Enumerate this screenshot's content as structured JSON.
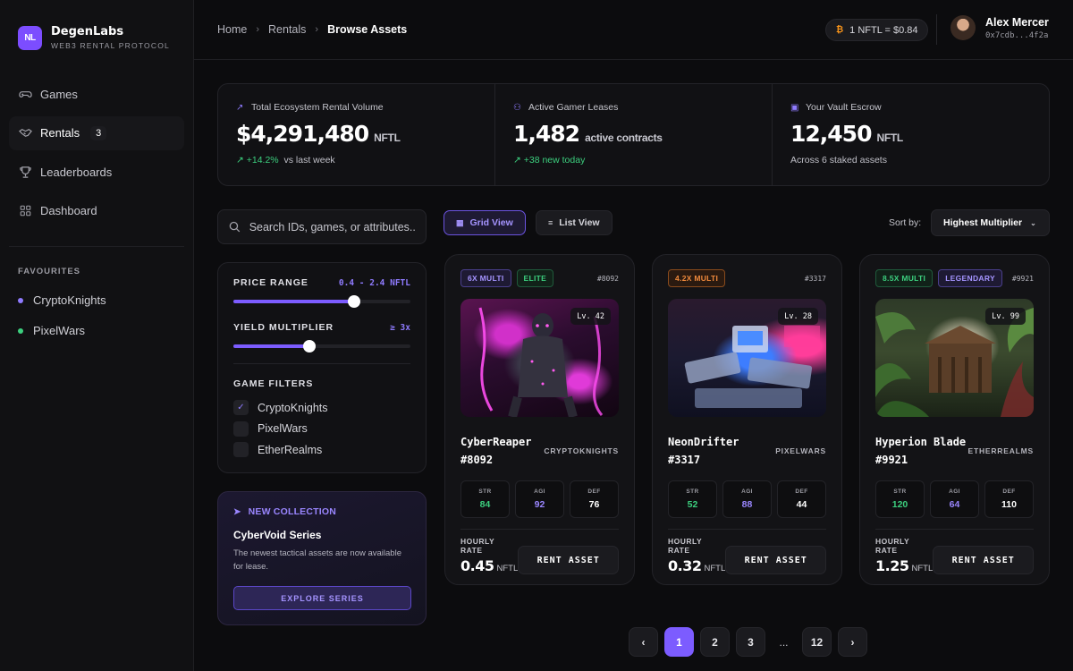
{
  "brand": {
    "logo": "NL",
    "name": "DegenLabs",
    "subtitle": "WEB3 RENTAL PROTOCOL"
  },
  "nav": [
    {
      "label": "Games",
      "icon": "gamepad-icon"
    },
    {
      "label": "Rentals",
      "icon": "handshake-icon",
      "badge": "3",
      "active": true
    },
    {
      "label": "Leaderboards",
      "icon": "trophy-icon"
    },
    {
      "label": "Dashboard",
      "icon": "grid-icon"
    }
  ],
  "favourites": {
    "title": "FAVOURITES",
    "items": [
      {
        "label": "CryptoKnights",
        "color": "#8f7bff"
      },
      {
        "label": "PixelWars",
        "color": "#3ccf7e"
      }
    ]
  },
  "breadcrumb": [
    "Home",
    "Rentals",
    "Browse Assets"
  ],
  "price_pill": {
    "icon": "bitcoin-icon",
    "text": "1 NFTL = $0.84"
  },
  "user": {
    "name": "Alex Mercer",
    "address": "0x7cdb...4f2a"
  },
  "stats": [
    {
      "icon": "chart-icon",
      "label": "Total Ecosystem Rental Volume",
      "value": "$4,291,480",
      "unit": "NFTL",
      "delta": "+14.2%",
      "sub": "vs last week"
    },
    {
      "icon": "users-icon",
      "label": "Active Gamer Leases",
      "value": "1,482",
      "unit": "active contracts",
      "delta": "+38 new today",
      "sub": ""
    },
    {
      "icon": "vault-icon",
      "label": "Your Vault Escrow",
      "value": "12,450",
      "unit": "NFTL",
      "delta": "",
      "sub": "Across 6 staked assets"
    }
  ],
  "search": {
    "placeholder": "Search IDs, games, or attributes..."
  },
  "filters": {
    "price_title": "PRICE RANGE",
    "price_value": "0.4 - 2.4 NFTL",
    "price_fill_pct": 68,
    "yield_title": "YIELD MULTIPLIER",
    "yield_value": "≥ 3x",
    "yield_fill_pct": 43,
    "games_title": "GAME FILTERS",
    "games": [
      {
        "label": "CryptoKnights",
        "checked": true
      },
      {
        "label": "PixelWars",
        "checked": false
      },
      {
        "label": "EtherRealms",
        "checked": false
      }
    ]
  },
  "promo": {
    "tag": "NEW COLLECTION",
    "title": "CyberVoid Series",
    "desc": "The newest tactical assets are now available for lease.",
    "button": "EXPLORE SERIES"
  },
  "view": {
    "grid_label": "Grid View",
    "list_label": "List View"
  },
  "sort": {
    "label": "Sort by:",
    "value": "Highest Multiplier"
  },
  "cards": [
    {
      "tags": [
        {
          "text": "6X MULTI",
          "style": "purple"
        },
        {
          "text": "ELITE",
          "style": "green"
        }
      ],
      "id": "#8092",
      "level": "Lv. 42",
      "name_lines": [
        "CyberReaper",
        "#8092"
      ],
      "game": "CRYPTOKNIGHTS",
      "str": "84",
      "agi": "92",
      "def": "76",
      "rate_label": "HOURLY RATE",
      "rate": "0.45",
      "unit": "NFTL",
      "button": "RENT ASSET"
    },
    {
      "tags": [
        {
          "text": "4.2X MULTI",
          "style": "orange"
        }
      ],
      "id": "#3317",
      "level": "Lv. 28",
      "name_lines": [
        "NeonDrifter #3317"
      ],
      "game": "PIXELWARS",
      "str": "52",
      "agi": "88",
      "def": "44",
      "rate_label": "HOURLY RATE",
      "rate": "0.32",
      "unit": "NFTL",
      "button": "RENT ASSET"
    },
    {
      "tags": [
        {
          "text": "8.5X MULTI",
          "style": "green"
        },
        {
          "text": "LEGENDARY",
          "style": "purple"
        }
      ],
      "id": "#9921",
      "level": "Lv. 99",
      "name_lines": [
        "Hyperion Blade",
        "#9921"
      ],
      "game": "ETHERREALMS",
      "str": "120",
      "agi": "64",
      "def": "110",
      "rate_label": "HOURLY RATE",
      "rate": "1.25",
      "unit": "NFTL",
      "button": "RENT ASSET"
    }
  ],
  "stat_labels": {
    "str": "STR",
    "agi": "AGI",
    "def": "DEF"
  },
  "pagination": {
    "pages": [
      "1",
      "2",
      "3"
    ],
    "ellipsis": "...",
    "last": "12",
    "current": "1"
  }
}
